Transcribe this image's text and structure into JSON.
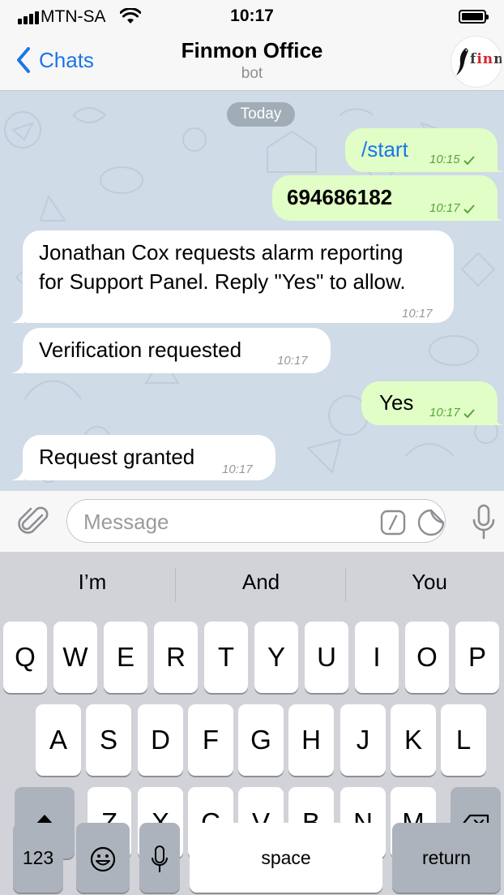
{
  "status_bar": {
    "carrier": "MTN-SA",
    "time": "10:17"
  },
  "nav": {
    "back_label": "Chats",
    "title": "Finmon Office",
    "subtitle": "bot",
    "avatar_text_prefix": "f",
    "avatar_text_highlight": "in",
    "avatar_text_suffix": "m"
  },
  "chat": {
    "date_separator": "Today",
    "messages": [
      {
        "direction": "outgoing",
        "text": "/start",
        "time": "10:15",
        "read": true
      },
      {
        "direction": "outgoing",
        "text": "694686182",
        "time": "10:17",
        "read": true
      },
      {
        "direction": "incoming",
        "line1": "Jonathan Cox requests alarm reporting",
        "line2": "for Support Panel. Reply \"Yes\" to allow.",
        "time": "10:17"
      },
      {
        "direction": "incoming",
        "text": "Verification requested",
        "time": "10:17"
      },
      {
        "direction": "outgoing",
        "text": "Yes",
        "time": "10:17",
        "read": true
      },
      {
        "direction": "incoming",
        "text": "Request granted",
        "time": "10:17"
      }
    ]
  },
  "input": {
    "placeholder": "Message"
  },
  "keyboard": {
    "suggestions": [
      "I’m",
      "And",
      "You"
    ],
    "row1": [
      "Q",
      "W",
      "E",
      "R",
      "T",
      "Y",
      "U",
      "I",
      "O",
      "P"
    ],
    "row2": [
      "A",
      "S",
      "D",
      "F",
      "G",
      "H",
      "J",
      "K",
      "L"
    ],
    "row3": [
      "Z",
      "X",
      "C",
      "V",
      "B",
      "N",
      "M"
    ],
    "numbers_label": "123",
    "space_label": "space",
    "return_label": "return"
  },
  "colors": {
    "accent": "#1a76e8",
    "outgoing_bubble": "#e1fec6",
    "incoming_bubble": "#ffffff",
    "chat_background": "#cfdbe6",
    "time_outgoing": "#58a53b"
  },
  "icons": [
    "signal-icon",
    "wifi-icon",
    "battery-icon",
    "back-chevron-icon",
    "attach-icon",
    "command-icon",
    "sticker-icon",
    "mic-icon",
    "shift-icon",
    "backspace-icon",
    "emoji-icon",
    "dictation-icon",
    "read-check-icon"
  ]
}
